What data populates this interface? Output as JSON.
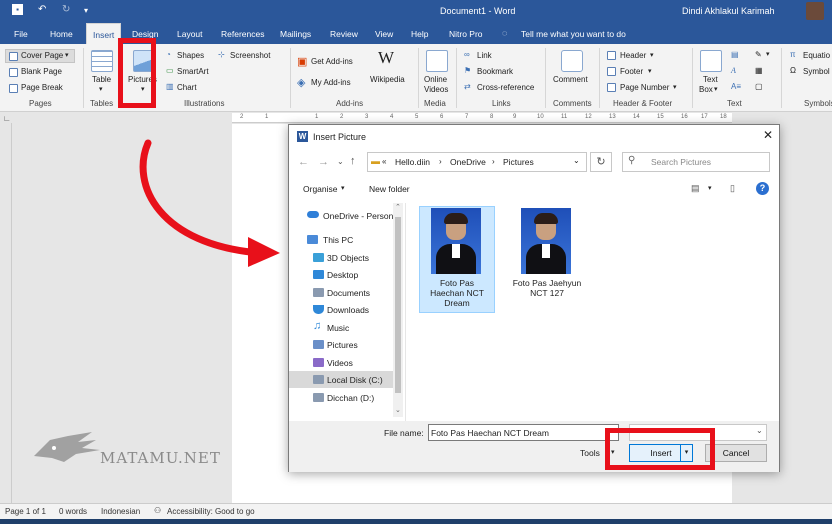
{
  "titlebar": {
    "doc_title": "Document1 - Word",
    "user": "Dindi Akhlakul Karimah"
  },
  "tabs": [
    "File",
    "Home",
    "Insert",
    "Design",
    "Layout",
    "References",
    "Mailings",
    "Review",
    "View",
    "Help",
    "Nitro Pro"
  ],
  "tell_me": "Tell me what you want to do",
  "ribbon": {
    "pages": {
      "cover": "Cover Page",
      "blank": "Blank Page",
      "break": "Page Break",
      "label": "Pages"
    },
    "tables": {
      "table": "Table",
      "label": "Tables"
    },
    "illustrations": {
      "pictures": "Pictures",
      "shapes": "Shapes",
      "smartart": "SmartArt",
      "chart": "Chart",
      "screenshot": "Screenshot",
      "label": "Illustrations"
    },
    "addins": {
      "get": "Get Add-ins",
      "my": "My Add-ins",
      "wiki": "Wikipedia",
      "label": "Add-ins"
    },
    "media": {
      "online": "Online",
      "videos": "Videos",
      "label": "Media"
    },
    "links": {
      "link": "Link",
      "bookmark": "Bookmark",
      "crossref": "Cross-reference",
      "label": "Links"
    },
    "comments": {
      "comment": "Comment",
      "label": "Comments"
    },
    "headerfooter": {
      "header": "Header",
      "footer": "Footer",
      "pagenum": "Page Number",
      "label": "Header & Footer"
    },
    "text": {
      "textbox1": "Text",
      "textbox2": "Box",
      "label": "Text"
    },
    "symbols": {
      "equation": "Equatio",
      "symbol": "Symbol",
      "label": "Symbols"
    }
  },
  "ruler_ticks": [
    "2",
    "1",
    "1",
    "2",
    "3",
    "4",
    "5",
    "6",
    "7",
    "8",
    "9",
    "10",
    "11",
    "12",
    "13",
    "14",
    "15",
    "16",
    "17",
    "18"
  ],
  "dialog": {
    "title": "Insert Picture",
    "breadcrumb": [
      "Hello.diin",
      "OneDrive",
      "Pictures"
    ],
    "search_placeholder": "Search Pictures",
    "organise": "Organise",
    "new_folder": "New folder",
    "nav": [
      {
        "label": "OneDrive - Person",
        "color": "#2f7fd8"
      },
      {
        "label": "This PC",
        "color": "#4a8ad8"
      },
      {
        "label": "3D Objects",
        "color": "#3aa0d8"
      },
      {
        "label": "Desktop",
        "color": "#2f88d8"
      },
      {
        "label": "Documents",
        "color": "#8a9ab0"
      },
      {
        "label": "Downloads",
        "color": "#2f88d8"
      },
      {
        "label": "Music",
        "color": "#2f88d8"
      },
      {
        "label": "Pictures",
        "color": "#6a8fc8"
      },
      {
        "label": "Videos",
        "color": "#8a6ac8"
      },
      {
        "label": "Local Disk (C:)",
        "color": "#8a9ab0"
      },
      {
        "label": "Dicchan (D:)",
        "color": "#8a9ab0"
      }
    ],
    "files": [
      {
        "l1": "Foto Pas",
        "l2": "Haechan NCT",
        "l3": "Dream"
      },
      {
        "l1": "Foto Pas Jaehyun",
        "l2": "NCT 127",
        "l3": ""
      }
    ],
    "filename_label": "File name:",
    "filename_value": "Foto Pas Haechan NCT Dream",
    "tools": "Tools",
    "insert": "Insert",
    "cancel": "Cancel"
  },
  "status": {
    "page": "Page 1 of 1",
    "words": "0 words",
    "lang": "Indonesian",
    "access": "Accessibility: Good to go"
  },
  "watermark": "MATAMU.NET"
}
